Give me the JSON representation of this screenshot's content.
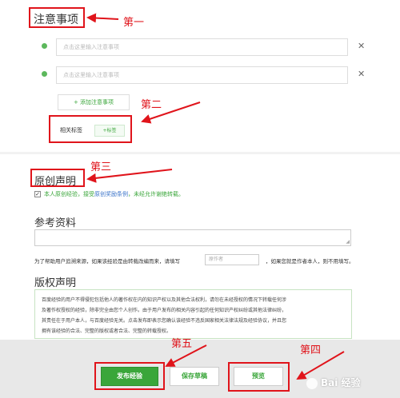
{
  "notes_section": {
    "title": "注意事项",
    "placeholders": [
      "点击这里输入注意事项",
      "点击这里输入注意事项"
    ],
    "add_button": "+ 添加注意事项",
    "tags_label": "相关标签",
    "add_tag_button": "+标签"
  },
  "original_section": {
    "title": "原创声明",
    "checked": true,
    "text_before_link": "本人原创经验，接受",
    "link_text": "原创奖励条例",
    "text_after_link": "，未经允许谢绝转载。"
  },
  "references_section": {
    "title": "参考资料",
    "help_text_before": "为了帮助用户追溯来源，如果该经验是由转载改编而来，请填写",
    "author_placeholder": "原作者",
    "help_text_after": "，如果您就是作者本人，则不用填写。"
  },
  "copyright_section": {
    "title": "版权声明",
    "lines": [
      "百度经验的用户不得侵犯包括他人的著作权在内的知识产权以及其他合法权利，请勿在未经授权的情况下转载任何涉",
      "及著作权授权的经验，除非完全由您个人创作。由于用户发布的相关内容引起的任何知识产权纠纷或其他法律纠纷，",
      "其责任在于用户本人，与百度经验无关。点击发布即表示您确认该经验不违反国家相关法律法规及经验协议，并且您",
      "拥有该经验的合法、完整的版权或者合法、完整的转载授权。"
    ]
  },
  "footer": {
    "publish": "发布经验",
    "save_draft": "保存草稿",
    "preview": "预览"
  },
  "annotations": {
    "first": "第一",
    "second": "第二",
    "third": "第三",
    "fourth": "第四",
    "fifth": "第五"
  },
  "watermark": "Bai 经验",
  "colors": {
    "accent_green": "#3aa63a",
    "annotation_red": "#e0141b",
    "link_blue": "#3a73c9"
  }
}
